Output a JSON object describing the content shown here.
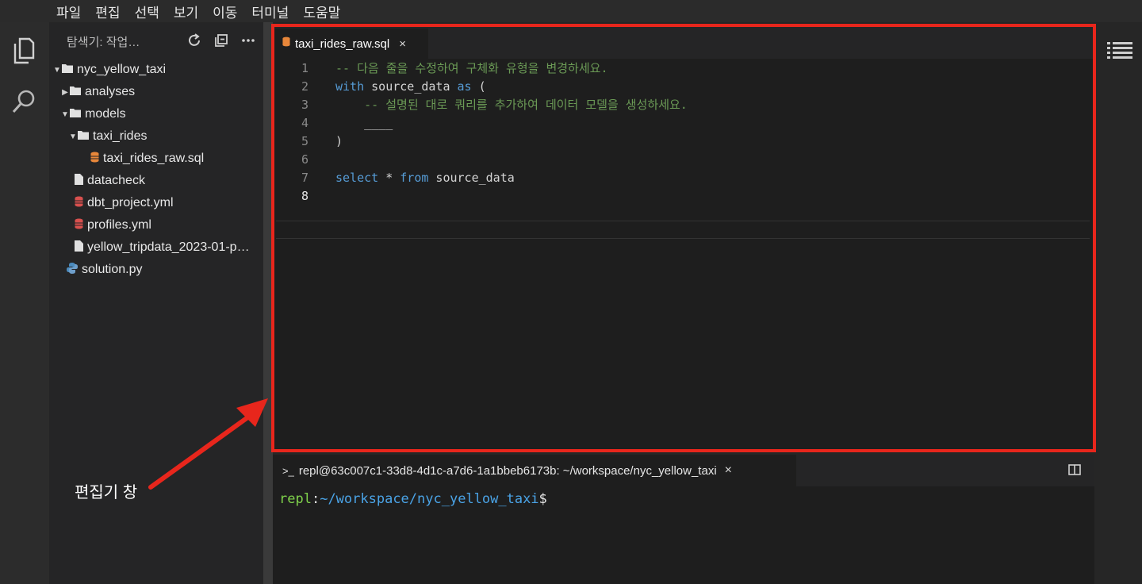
{
  "menubar": {
    "items": [
      "파일",
      "편집",
      "선택",
      "보기",
      "이동",
      "터미널",
      "도움말"
    ]
  },
  "sidebar": {
    "title": "탐색기: 작업…",
    "tree": [
      {
        "label": "nyc_yellow_taxi",
        "indent": 0,
        "type": "folder",
        "expanded": true
      },
      {
        "label": "analyses",
        "indent": 1,
        "type": "folder",
        "expanded": false
      },
      {
        "label": "models",
        "indent": 1,
        "type": "folder",
        "expanded": true
      },
      {
        "label": "taxi_rides",
        "indent": 2,
        "type": "folder",
        "expanded": true
      },
      {
        "label": "taxi_rides_raw.sql",
        "indent": 3,
        "type": "sql"
      },
      {
        "label": "datacheck",
        "indent": 1,
        "type": "file"
      },
      {
        "label": "dbt_project.yml",
        "indent": 1,
        "type": "yml"
      },
      {
        "label": "profiles.yml",
        "indent": 1,
        "type": "yml"
      },
      {
        "label": "yellow_tripdata_2023-01-p…",
        "indent": 1,
        "type": "file"
      },
      {
        "label": "solution.py",
        "indent": 0,
        "type": "py"
      }
    ]
  },
  "editor": {
    "tab": {
      "label": "taxi_rides_raw.sql",
      "close": "×"
    },
    "lines": [
      {
        "n": "1",
        "tokens": [
          {
            "t": "-- 다음 줄을 수정하여 구체화 유형을 변경하세요.",
            "c": "cmt"
          }
        ]
      },
      {
        "n": "2",
        "tokens": [
          {
            "t": "with",
            "c": "kw"
          },
          {
            "t": " source_data ",
            "c": "id"
          },
          {
            "t": "as",
            "c": "kw"
          },
          {
            "t": " (",
            "c": "id"
          }
        ]
      },
      {
        "n": "3",
        "tokens": [
          {
            "t": "    -- 설명된 대로 쿼리를 추가하여 데이터 모델을 생성하세요.",
            "c": "cmt"
          }
        ]
      },
      {
        "n": "4",
        "tokens": [
          {
            "t": "    ____",
            "c": "id"
          }
        ]
      },
      {
        "n": "5",
        "tokens": [
          {
            "t": ")",
            "c": "id"
          }
        ]
      },
      {
        "n": "6",
        "tokens": []
      },
      {
        "n": "7",
        "tokens": [
          {
            "t": "select",
            "c": "kw"
          },
          {
            "t": " * ",
            "c": "id"
          },
          {
            "t": "from",
            "c": "kw"
          },
          {
            "t": " source_data",
            "c": "id"
          }
        ]
      },
      {
        "n": "8",
        "tokens": []
      }
    ]
  },
  "terminal": {
    "tab_label": "repl@63c007c1-33d8-4d1c-a7d6-1a1bbeb6173b: ~/workspace/nyc_yellow_taxi",
    "tab_prefix": ">_",
    "close": "×",
    "prompt_user": "repl",
    "prompt_colon": ":",
    "prompt_path": "~/workspace/nyc_yellow_taxi",
    "prompt_dollar": "$"
  },
  "annotation": {
    "label": "편집기 창",
    "color": "#e8261c"
  }
}
